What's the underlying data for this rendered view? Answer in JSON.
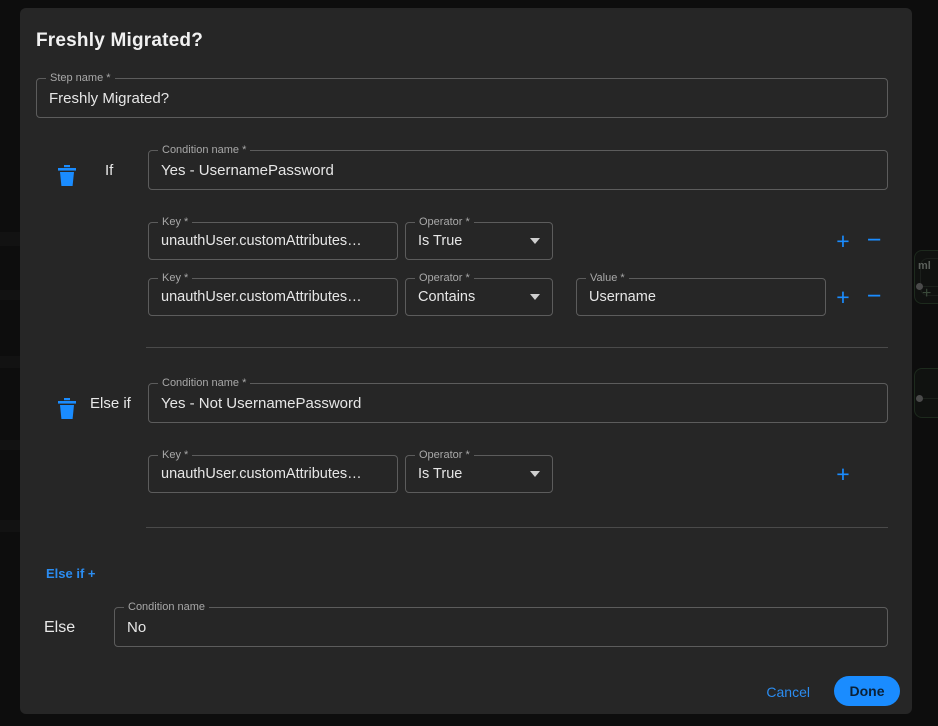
{
  "modal": {
    "title": "Freshly Migrated?",
    "step_name": {
      "label": "Step name",
      "required": "*",
      "value": "Freshly Migrated?"
    },
    "branches": [
      {
        "keyword": "If",
        "delete_icon": "trash-icon",
        "condition": {
          "label": "Condition name",
          "required": "*",
          "value": "Yes - UsernamePassword"
        },
        "rules": [
          {
            "key": {
              "label": "Key",
              "required": "*",
              "value": "unauthUser.customAttributes…"
            },
            "operator": {
              "label": "Operator",
              "required": "*",
              "value": "Is True"
            },
            "has_value_field": false,
            "add_label": "+",
            "remove_label": "−"
          },
          {
            "key": {
              "label": "Key",
              "required": "*",
              "value": "unauthUser.customAttributes…"
            },
            "operator": {
              "label": "Operator",
              "required": "*",
              "value": "Contains"
            },
            "has_value_field": true,
            "value_field": {
              "label": "Value",
              "required": "*",
              "value": "Username"
            },
            "add_label": "+",
            "remove_label": "−"
          }
        ]
      },
      {
        "keyword": "Else if",
        "delete_icon": "trash-icon",
        "condition": {
          "label": "Condition name",
          "required": "*",
          "value": "Yes - Not UsernamePassword"
        },
        "rules": [
          {
            "key": {
              "label": "Key",
              "required": "*",
              "value": "unauthUser.customAttributes…"
            },
            "operator": {
              "label": "Operator",
              "required": "*",
              "value": "Is True"
            },
            "has_value_field": false,
            "add_label": "+",
            "remove_label": ""
          }
        ]
      }
    ],
    "add_else_if_link": "Else if +",
    "else_branch": {
      "keyword": "Else",
      "condition": {
        "label": "Condition name",
        "required": "",
        "value": "No"
      }
    },
    "footer": {
      "cancel_label": "Cancel",
      "done_label": "Done"
    }
  },
  "background": {
    "node_label": "ml",
    "plus_glyph": "+"
  },
  "colors": {
    "accent_blue": "#1a8cff",
    "link_blue": "#2b8cf0",
    "modal_bg": "#262626",
    "page_bg": "#0d0d0d",
    "field_border": "#5c5c5c",
    "text_primary": "#e6e6e6",
    "text_label": "#a8a8a8"
  }
}
